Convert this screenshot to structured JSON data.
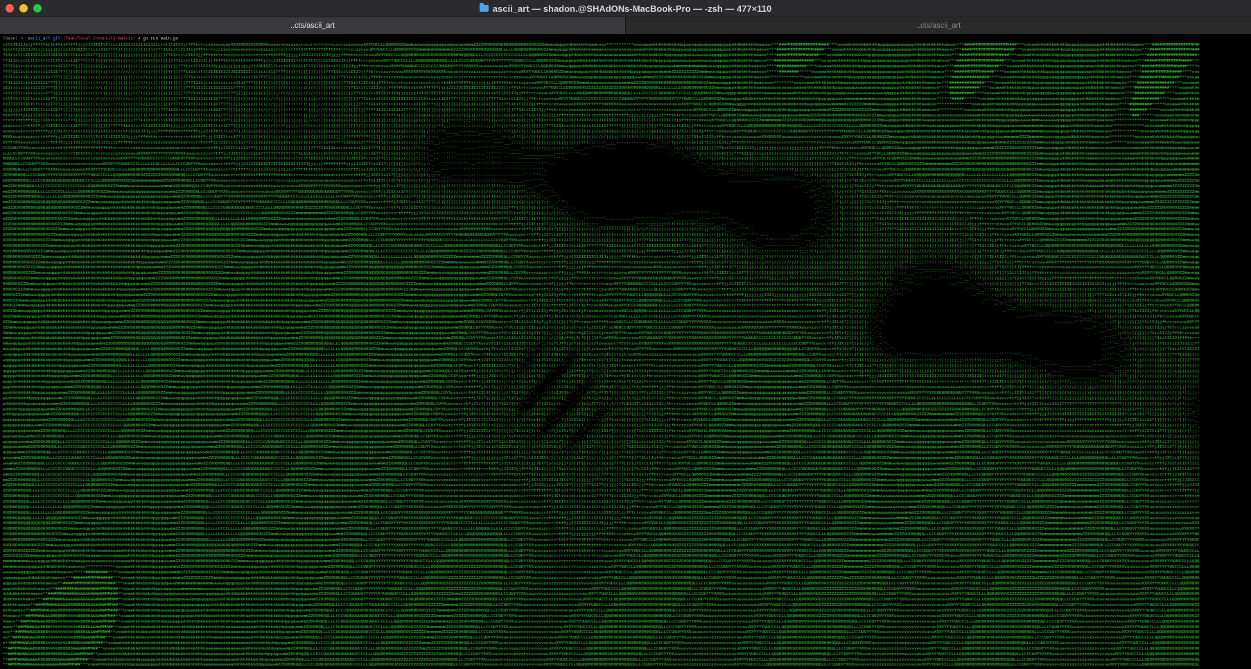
{
  "window": {
    "title": "ascii_art — shadon.@SHAdONs-MacBook-Pro — -zsh — 477×110",
    "title_icon": "folder-icon"
  },
  "tabs": [
    {
      "label": "..cts/ascii_art",
      "active": true
    },
    {
      "label": "..cts/ascii_art",
      "active": false
    }
  ],
  "terminal": {
    "prompt": {
      "env": "(base)",
      "arrow": "➜",
      "dir": "ascii_art",
      "git": "git:(",
      "branch": "feat/local-intensity-matrix",
      "git_close": ")",
      "marker": "✗",
      "command": "go run main.go"
    },
    "art_color": "#3fe23f",
    "background": "#000000"
  },
  "colors": {
    "close": "#ff5f57",
    "minimize": "#febc2e",
    "zoom": "#28c840",
    "ascii_green": "#3fe23f"
  }
}
